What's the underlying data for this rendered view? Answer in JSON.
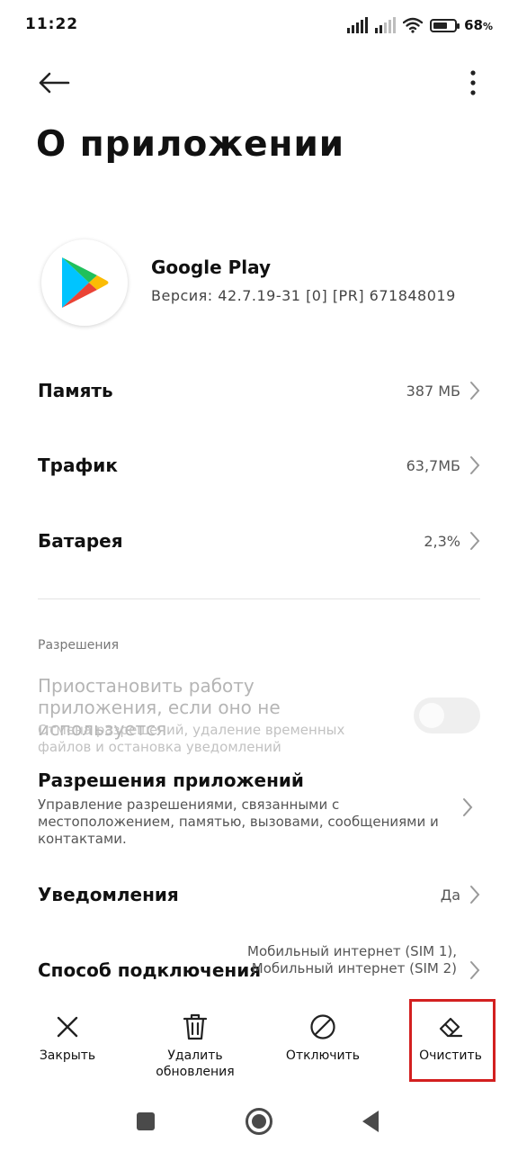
{
  "status_bar": {
    "time": "11:22",
    "battery_level": "68",
    "battery_unit": "%",
    "battery_fraction": 0.68
  },
  "header": {
    "title": "О приложении"
  },
  "app": {
    "name": "Google Play",
    "version": "Версия: 42.7.19-31 [0] [PR] 671848019"
  },
  "rows": {
    "memory": {
      "label": "Память",
      "value": "387 МБ"
    },
    "traffic": {
      "label": "Трафик",
      "value": "63,7МБ"
    },
    "battery": {
      "label": "Батарея",
      "value": "2,3%"
    }
  },
  "permissions": {
    "section_title": "Разрешения",
    "pause": {
      "title": "Приостановить работу приложения, если оно не используется",
      "subtitle": "Отмена разрешений, удаление временных файлов и остановка уведомлений",
      "enabled": false
    },
    "app_permissions": {
      "title": "Разрешения приложений",
      "subtitle": "Управление разрешениями, связанными с местоположением, памятью, вызовами, сообщениями и контактами."
    }
  },
  "notifications": {
    "label": "Уведомления",
    "value": "Да"
  },
  "connection": {
    "label": "Способ подключения",
    "value": "Мобильный интернет (SIM 1), Мобильный интернет (SIM 2)"
  },
  "actions": {
    "close": "Закрыть",
    "delete_updates": "Удалить обновления",
    "disable": "Отключить",
    "clear": "Очистить"
  },
  "icons": {
    "back": "arrow-left-icon",
    "menu": "more-vert-icon",
    "chevron": "chevron-right-icon",
    "close": "x-icon",
    "delete": "trash-icon",
    "disable": "block-icon",
    "clear": "eraser-icon"
  },
  "colors": {
    "highlight": "#d32020",
    "disabled_text": "#b5b5b5"
  }
}
